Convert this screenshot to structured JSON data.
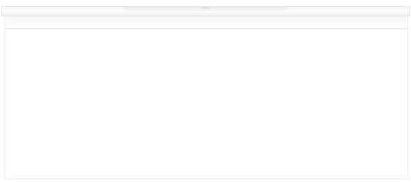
{
  "product": {
    "name": "",
    "colors": {
      "cabinet": "#ffffff",
      "countertop": "#f6f6f6",
      "edge": "#e6e6e6"
    }
  }
}
